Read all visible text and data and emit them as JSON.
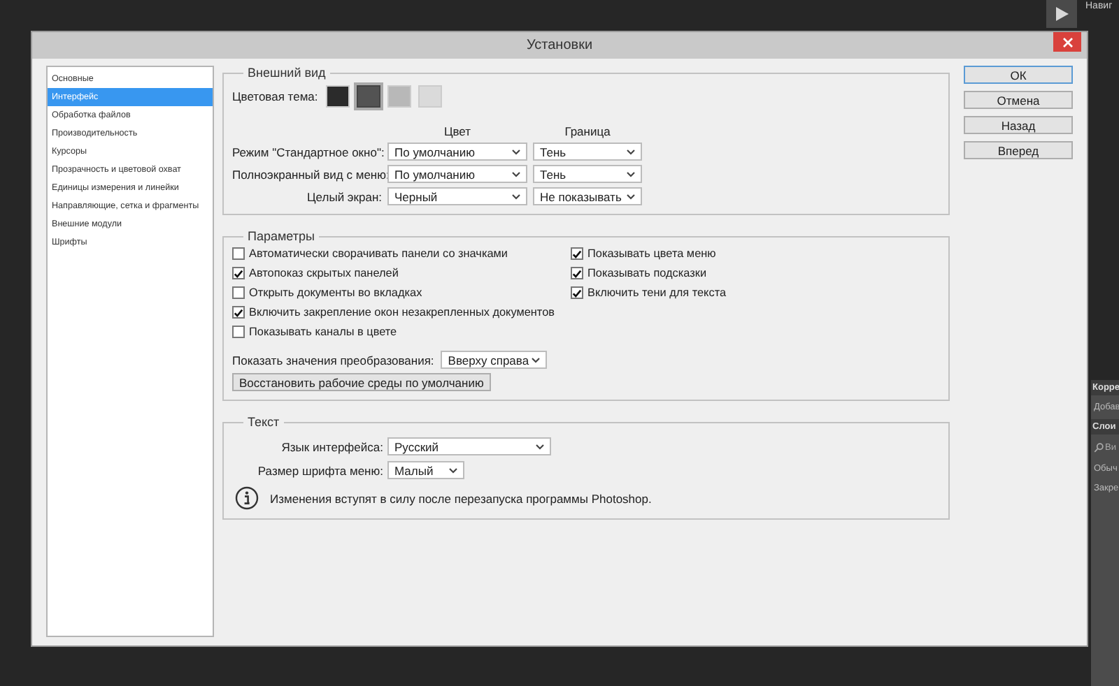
{
  "window": {
    "title": "Установки"
  },
  "app_panel": {
    "top_label": "Навиг",
    "items": [
      {
        "kind": "heading",
        "label": "Корре"
      },
      {
        "kind": "text",
        "label": "Добав"
      },
      {
        "kind": "heading",
        "label": "Слои"
      },
      {
        "kind": "search",
        "label": "Ви"
      },
      {
        "kind": "text",
        "label": "Обыч"
      },
      {
        "kind": "text",
        "label": "Закре"
      }
    ]
  },
  "sidebar": {
    "items": [
      {
        "label": "Основные",
        "selected": false
      },
      {
        "label": "Интерфейс",
        "selected": true
      },
      {
        "label": "Обработка файлов",
        "selected": false
      },
      {
        "label": "Производительность",
        "selected": false
      },
      {
        "label": "Курсоры",
        "selected": false
      },
      {
        "label": "Прозрачность и цветовой охват",
        "selected": false
      },
      {
        "label": "Единицы измерения и линейки",
        "selected": false
      },
      {
        "label": "Направляющие, сетка и фрагменты",
        "selected": false
      },
      {
        "label": "Внешние модули",
        "selected": false
      },
      {
        "label": "Шрифты",
        "selected": false
      }
    ]
  },
  "appearance": {
    "title": "Внешний вид",
    "theme_label": "Цветовая тема:",
    "themes": [
      {
        "color": "#2b2b2b",
        "selected": false
      },
      {
        "color": "#535353",
        "selected": true
      },
      {
        "color": "#b8b8b8",
        "selected": false
      },
      {
        "color": "#dadada",
        "selected": false
      }
    ],
    "columns": [
      "Цвет",
      "Граница"
    ],
    "rows": [
      {
        "label": "Режим \"Стандартное окно\":",
        "color_mode": "По умолчанию",
        "border": "Тень"
      },
      {
        "label": "Полноэкранный вид с меню:",
        "color_mode": "По умолчанию",
        "border": "Тень"
      },
      {
        "label": "Целый экран:",
        "color_mode": "Черный",
        "border": "Не показывать"
      }
    ]
  },
  "parameters": {
    "title": "Параметры",
    "left": [
      {
        "label": "Автоматически сворачивать панели со значками",
        "checked": false
      },
      {
        "label": "Автопоказ скрытых панелей",
        "checked": true
      },
      {
        "label": "Открыть документы во вкладках",
        "checked": false
      },
      {
        "label": "Включить закрепление окон незакрепленных документов",
        "checked": true
      },
      {
        "label": "Показывать каналы в цвете",
        "checked": false
      }
    ],
    "right": [
      {
        "label": "Показывать цвета меню",
        "checked": true
      },
      {
        "label": "Показывать подсказки",
        "checked": true
      },
      {
        "label": "Включить тени для текста",
        "checked": true
      }
    ],
    "transform": {
      "label": "Показать значения преобразования:",
      "value": "Вверху справа"
    },
    "reset_button": "Восстановить рабочие среды по умолчанию"
  },
  "text_group": {
    "title": "Текст",
    "language": {
      "label": "Язык интерфейса:",
      "value": "Русский"
    },
    "font_size": {
      "label": "Размер шрифта меню:",
      "value": "Малый"
    },
    "note": "Изменения вступят в силу после перезапуска программы Photoshop."
  },
  "buttons": [
    {
      "label": "ОК",
      "default": true
    },
    {
      "label": "Отмена",
      "default": false
    },
    {
      "label": "Назад",
      "default": false
    },
    {
      "label": "Вперед",
      "default": false
    }
  ]
}
